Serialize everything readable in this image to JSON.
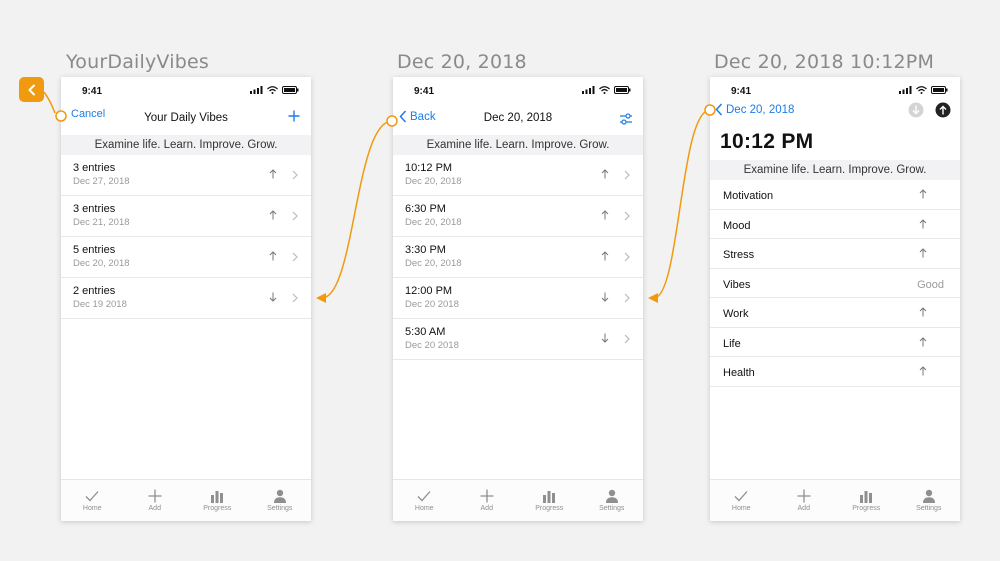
{
  "labels": [
    "YourDailyVibes",
    "Dec 20, 2018",
    "Dec 20, 2018 10:12PM"
  ],
  "status_time": "9:41",
  "banner": "Examine life. Learn. Improve. Grow.",
  "tabs": [
    {
      "label": "Home",
      "icon": "check-icon"
    },
    {
      "label": "Add",
      "icon": "plus-icon"
    },
    {
      "label": "Progress",
      "icon": "bar-chart-icon"
    },
    {
      "label": "Settings",
      "icon": "person-icon"
    }
  ],
  "screen1": {
    "cancel": "Cancel",
    "title": "Your Daily Vibes",
    "rows": [
      {
        "main": "3 entries",
        "sub": "Dec 27, 2018",
        "trend": "up"
      },
      {
        "main": "3 entries",
        "sub": "Dec 21, 2018",
        "trend": "up"
      },
      {
        "main": "5 entries",
        "sub": "Dec 20, 2018",
        "trend": "up"
      },
      {
        "main": "2 entries",
        "sub": "Dec 19 2018",
        "trend": "down"
      }
    ]
  },
  "screen2": {
    "back": "Back",
    "title": "Dec 20, 2018",
    "rows": [
      {
        "main": "10:12 PM",
        "sub": "Dec 20, 2018",
        "trend": "up"
      },
      {
        "main": "6:30 PM",
        "sub": "Dec 20, 2018",
        "trend": "up"
      },
      {
        "main": "3:30 PM",
        "sub": "Dec 20, 2018",
        "trend": "up"
      },
      {
        "main": "12:00 PM",
        "sub": "Dec 20 2018",
        "trend": "down"
      },
      {
        "main": "5:30 AM",
        "sub": "Dec 20 2018",
        "trend": "down"
      }
    ]
  },
  "screen3": {
    "back": "Dec 20, 2018",
    "big_time": "10:12 PM",
    "rows": [
      {
        "label": "Motivation",
        "value": ""
      },
      {
        "label": "Mood",
        "value": ""
      },
      {
        "label": "Stress",
        "value": ""
      },
      {
        "label": "Vibes",
        "value": "Good"
      },
      {
        "label": "Work",
        "value": ""
      },
      {
        "label": "Life",
        "value": ""
      },
      {
        "label": "Health",
        "value": ""
      }
    ]
  },
  "colors": {
    "accent": "#1d7ce8",
    "annotation": "#f09a0f"
  }
}
